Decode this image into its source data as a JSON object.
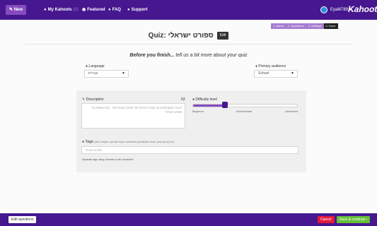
{
  "nav": {
    "new_label": "New",
    "my_kahoots_label": "My Kahoots",
    "my_kahoots_count": "(0)",
    "featured_label": "Featured",
    "faq_label": "FAQ",
    "support_label": "Support",
    "user_name": "Eyal6789",
    "logo_text": "Kahoot!"
  },
  "steps": [
    {
      "label": "1. Name",
      "active": false
    },
    {
      "label": "2. Questions",
      "active": false
    },
    {
      "label": "3. Settings",
      "active": false
    },
    {
      "label": "4. Done",
      "active": true
    }
  ],
  "quiz": {
    "prefix": "Quiz:",
    "name": "ספורט ישראלי",
    "edit_label": "Edit"
  },
  "finish": {
    "bold": "Before you finish...",
    "rest": " tell us a bit more about your quiz"
  },
  "language": {
    "label": "Language",
    "value": "עברית"
  },
  "audience": {
    "label": "Primary audience",
    "value": "School"
  },
  "description": {
    "label": "Description",
    "count": "63",
    "value": "לכבוד המשתתפים על עונות הכדורגל של ישראל בשנים אלה - כמה שאלות על ספורט ישראלי"
  },
  "difficulty": {
    "label": "Difficulty level",
    "value_fraction": 0.3,
    "beginner": "Beginner",
    "intermediate": "Intermediate",
    "advanced": "Advanced"
  },
  "tags": {
    "label": "Tags",
    "hint": "(skill, subject, specific topic, academic qualification level, year group etc.)",
    "value": "ספורט ישראלי",
    "separator_hint": "Separate tags using commas or tab characters"
  },
  "footer": {
    "edit_questions_label": "Edit questions",
    "cancel_label": "Cancel",
    "save_label": "Save & continue"
  },
  "colors": {
    "brand": "#46178f",
    "accent": "#864cbf",
    "cancel": "#e21b3c",
    "save": "#66bf39"
  }
}
